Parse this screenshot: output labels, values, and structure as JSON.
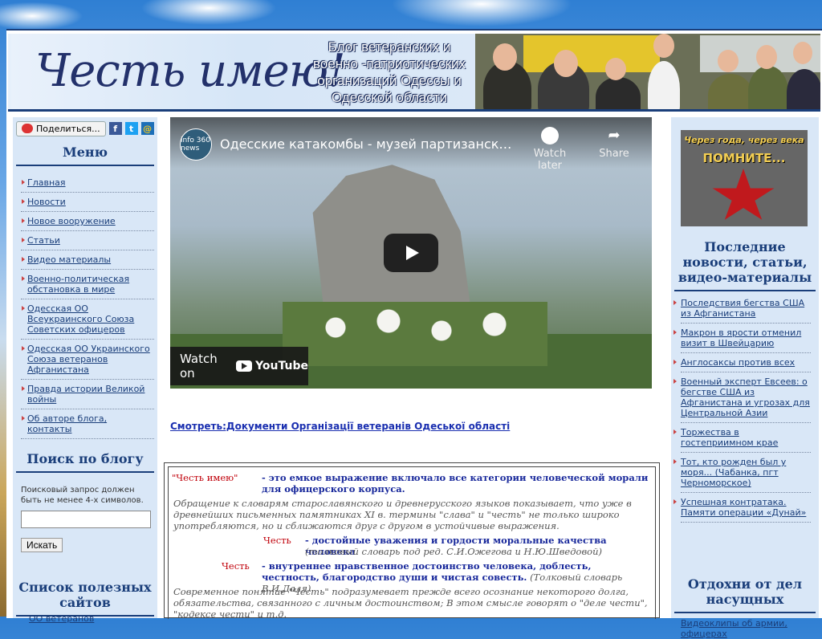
{
  "header": {
    "title": "Честь имею!",
    "subtitle": "Блог ветеранских и военно -патриотических организаций Одессы и Одесской области"
  },
  "share": {
    "label": "Поделиться...",
    "fb": "f",
    "tw": "t",
    "mail": "@"
  },
  "menu": {
    "title": "Меню",
    "items": [
      {
        "label": "Главная"
      },
      {
        "label": "Новости"
      },
      {
        "label": "Новое вооружение"
      },
      {
        "label": "Статьи"
      },
      {
        "label": "Видео материалы"
      },
      {
        "label": "Военно-политическая обстановка в мире"
      },
      {
        "label": "Одесская ОО Всеукраинского Союза Советских офицеров"
      },
      {
        "label": "Одесская ОО Украинского Союза ветеранов Афганистана"
      },
      {
        "label": "Правда истории Великой войны"
      },
      {
        "label": "Об авторе блога, контакты"
      }
    ]
  },
  "search": {
    "title": "Поиск по блогу",
    "note": "Поисковый запрос должен быть не менее 4-х символов.",
    "button": "Искать"
  },
  "sites": {
    "title": "Список полезных сайтов",
    "first": "ОО ветеранов"
  },
  "video": {
    "channel": "info 360 news",
    "title": "Одесские катакомбы - музей партизанской славы",
    "watch_later": "Watch later",
    "share": "Share",
    "watch_on": "Watch on",
    "youtube": "YouTube"
  },
  "doc_link": "Смотреть:Документи Організації ветеранів Одеської області",
  "quote": {
    "term1": "\"Честь имею\"",
    "def1": "- это емкое выражение включало все категории человеческой морали для офицерского корпуса.",
    "para1": "Обращение к словарям старославянского и древнерусского языков показывает, что уже в древнейших письменных памятниках XI в. термины \"слава\" и \"честь\" не только широко употребляются, но и сближаются друг с другом в устойчивые выражения.",
    "term2": "Честь",
    "def2": "- достойные уважения и гордости моральные качества человека",
    "src2": "(толковый словарь под ред. С.И.Ожегова и Н.Ю.Шведовой)",
    "term3": "Честь",
    "def3": "- внутреннее нравственное достоинство человека, доблесть, честность, благородство души и чистая совесть.",
    "src3": "(Толковый словарь В.И.Даля)",
    "para2": "Современное понятие \"Честь\" подразумевает прежде всего осознание некоторого долга, обязательства, связанного с личным достоинством; В этом смысле говорят о \"деле чести\", \"кодексе чести\" и т.д."
  },
  "right": {
    "banner_top": "Через года, через века",
    "banner_main": "ПОМНИТЕ...",
    "news_title": "Последние новости, статьи, видео-материалы",
    "news": [
      {
        "label": "Последствия бегства США из Афганистана"
      },
      {
        "label": "Макрон в ярости отменил визит в Швейцарию"
      },
      {
        "label": "Англосаксы против всех"
      },
      {
        "label": "Военный эксперт Евсеев: о бегстве США из Афганистана и угрозах для Центральной Азии"
      },
      {
        "label": "Торжества в гостеприимном крае"
      },
      {
        "label": "Тот, кто рожден был у моря... (Чабанка, пгт Черноморское)"
      },
      {
        "label": "Успешная контратака. Памяти операции «Дунай»"
      }
    ],
    "rest_title": "Отдохни от дел насущных",
    "rest_item": "Видеоклипы об армии, офицерах"
  },
  "colors": {
    "accent": "#1a3e7a",
    "sidebar": "#d9e7f7",
    "red": "#c0000a"
  }
}
